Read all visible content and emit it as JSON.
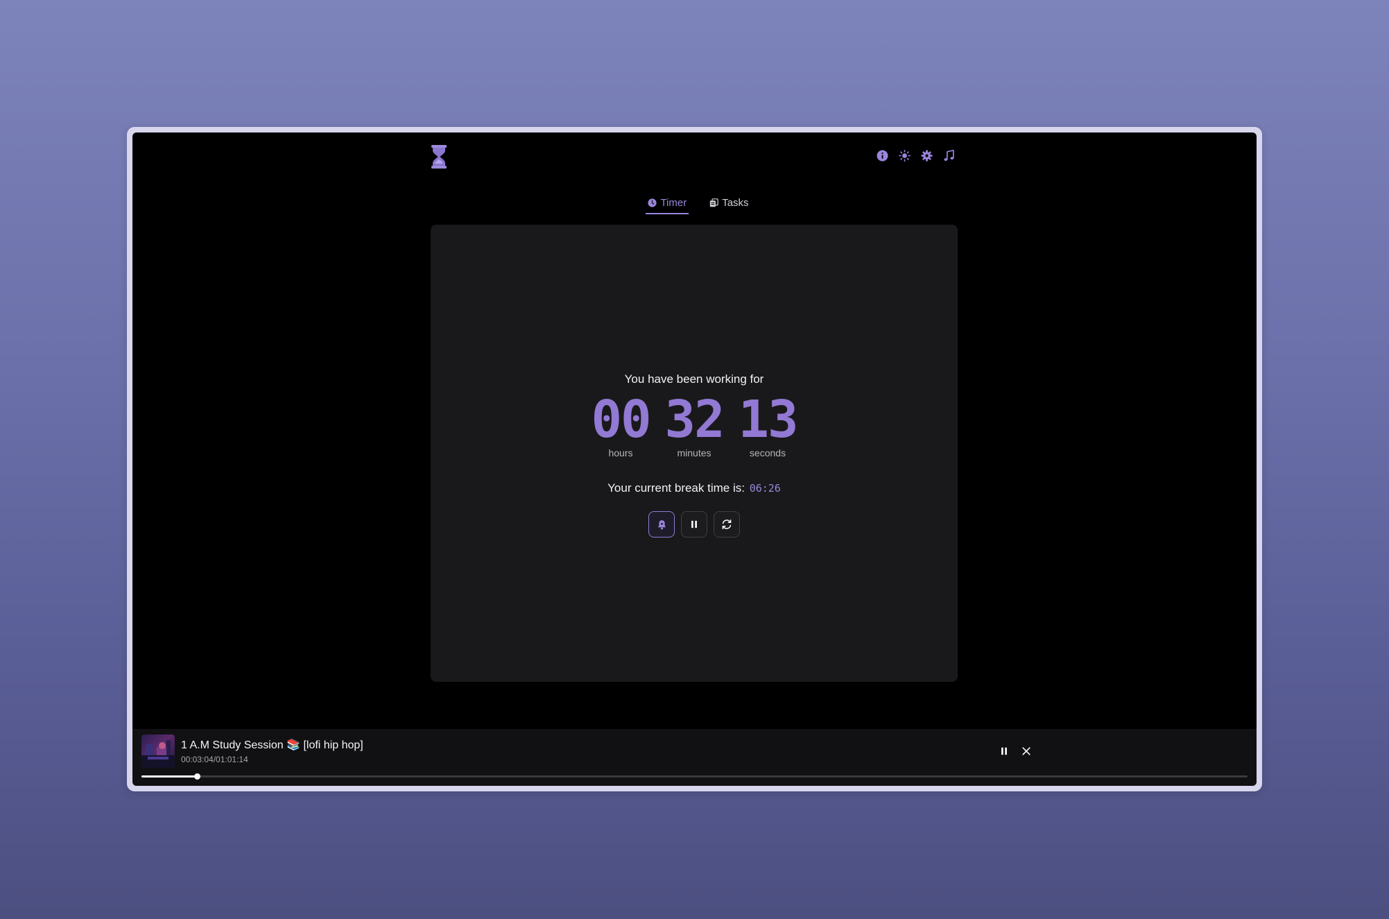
{
  "header": {
    "logo": "hourglass-icon",
    "icons": [
      "info-icon",
      "sun-icon",
      "gear-icon",
      "music-note-icon"
    ]
  },
  "tabs": [
    {
      "label": "Timer",
      "icon": "clock-icon",
      "active": true
    },
    {
      "label": "Tasks",
      "icon": "clipboard-icon",
      "active": false
    }
  ],
  "timer": {
    "heading": "You have been working for",
    "hours": "00",
    "hours_label": "hours",
    "minutes": "32",
    "minutes_label": "minutes",
    "seconds": "13",
    "seconds_label": "seconds",
    "break_label": "Your current break time is:",
    "break_time": "06:26",
    "controls": [
      "bell-icon",
      "pause-icon",
      "refresh-icon"
    ]
  },
  "player": {
    "title": "1 A.M Study Session 📚 [lofi hip hop]",
    "time": "00:03:04/01:01:14",
    "progress_percent": 5.0,
    "controls": [
      "pause-icon",
      "close-icon"
    ]
  },
  "colors": {
    "accent": "#9a85dc",
    "digits": "#9279d4",
    "card": "#19191b",
    "background": "#000000"
  }
}
